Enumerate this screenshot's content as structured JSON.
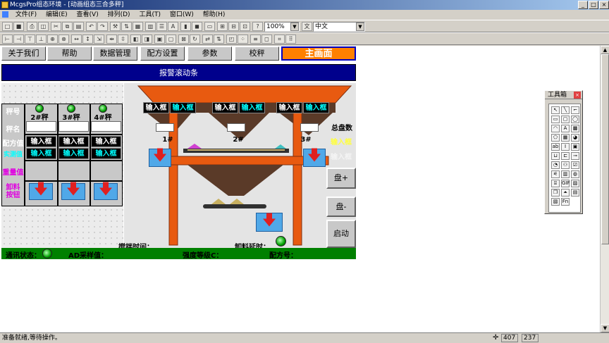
{
  "window": {
    "title": "McgsPro组态环境 - [动画组态三合多秤]"
  },
  "menu": [
    "文件(F)",
    "编辑(E)",
    "查看(V)",
    "排列(D)",
    "工具(T)",
    "窗口(W)",
    "帮助(H)"
  ],
  "toolbar": {
    "zoom": "100%",
    "language": "中文"
  },
  "nav": {
    "about": "关于我们",
    "help": "帮助",
    "data": "数据管理",
    "recipe": "配方设置",
    "params": "参数",
    "calib": "校秤",
    "main": "主画面"
  },
  "banner": "报警滚动条",
  "table": {
    "row_labels": [
      "秤号",
      "秤名",
      "配方值",
      "实测值",
      "重量值",
      "卸料按钮"
    ],
    "scales": [
      "2#秤",
      "3#秤",
      "4#秤"
    ],
    "input_label": "输入框"
  },
  "hopper": {
    "labels": [
      "1#",
      "2#",
      "3#"
    ],
    "inputs": [
      "输入框",
      "输入框",
      "输入框",
      "输入框",
      "输入框",
      "输入框"
    ],
    "total_label": "总盘数",
    "total_input": "输入框",
    "faded_input": "输入框"
  },
  "controls": {
    "plus": "盘+",
    "minus": "盘-",
    "start": "启动"
  },
  "timing": {
    "mix_time": "搅拌时间：",
    "discharge_delay": "卸料延时："
  },
  "status_strip": {
    "comm": "通讯状态：",
    "ad": "AD采样值：",
    "strength": "强度等级C：",
    "recipe_no": "配方号："
  },
  "toolbox": {
    "title": "工具箱"
  },
  "statusbar": {
    "text": "准备就绪,等待操作。",
    "x": "407",
    "y": "237"
  },
  "colors": {
    "frame": "#e85a10",
    "hopper": "#5a3a28",
    "accent": "#ff8000",
    "banner": "#00008c",
    "strip": "#008000"
  }
}
